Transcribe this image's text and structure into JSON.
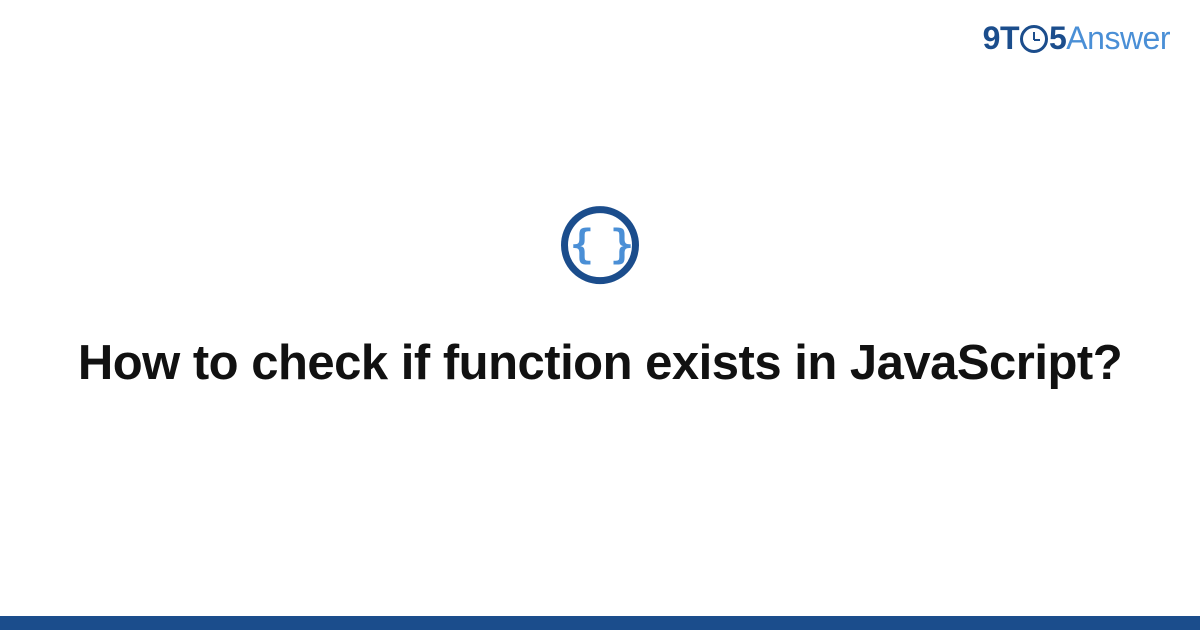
{
  "logo": {
    "part1": "9T",
    "part2": "5",
    "part3": "Answer"
  },
  "icon": {
    "glyph": "{ }",
    "name": "code-braces"
  },
  "title": "How to check if function exists in JavaScript?",
  "colors": {
    "primary": "#1b4d8c",
    "accent": "#4a8fd6"
  }
}
